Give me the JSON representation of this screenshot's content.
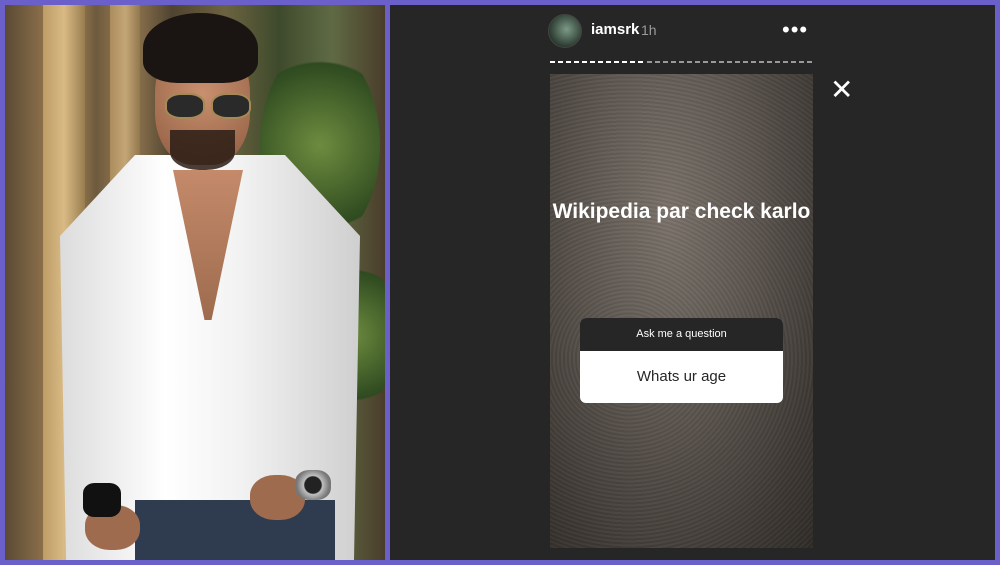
{
  "story": {
    "username": "iamsrk",
    "timestamp": "1h",
    "more_icon": "•••",
    "close_icon": "✕",
    "caption": "Wikipedia par check karlo",
    "question_sticker": {
      "prompt": "Ask me a question",
      "answer": "Whats ur age"
    },
    "progress_fraction": 0.36
  },
  "colors": {
    "border": "#6b5fc9",
    "panel_bg": "#262626"
  }
}
